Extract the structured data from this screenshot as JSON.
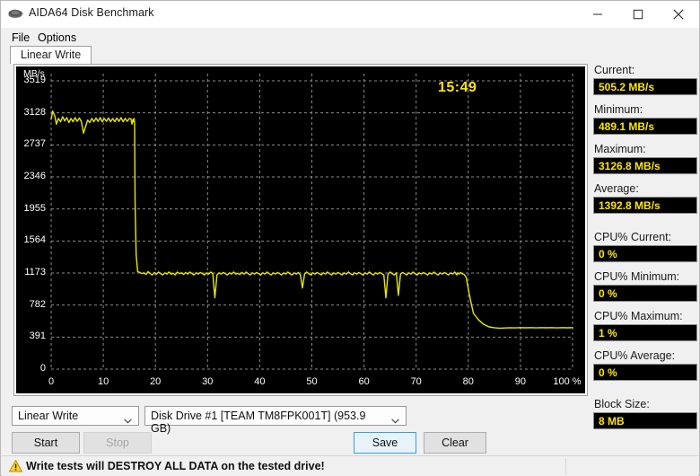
{
  "window": {
    "title": "AIDA64 Disk Benchmark",
    "app_icon": "disk-drive-icon",
    "minimize_label": "Minimize",
    "maximize_label": "Maximize",
    "close_label": "Close"
  },
  "menu": {
    "items": [
      "File",
      "Options"
    ]
  },
  "tabs": [
    {
      "label": "Linear Write",
      "active": true
    }
  ],
  "stats": [
    {
      "label": "Current:",
      "value": "505.2 MB/s",
      "gap": false
    },
    {
      "label": "Minimum:",
      "value": "489.1 MB/s",
      "gap": false
    },
    {
      "label": "Maximum:",
      "value": "3126.8 MB/s",
      "gap": false
    },
    {
      "label": "Average:",
      "value": "1392.8 MB/s",
      "gap": true
    },
    {
      "label": "CPU% Current:",
      "value": "0 %",
      "gap": false
    },
    {
      "label": "CPU% Minimum:",
      "value": "0 %",
      "gap": false
    },
    {
      "label": "CPU% Maximum:",
      "value": "1 %",
      "gap": false
    },
    {
      "label": "CPU% Average:",
      "value": "0 %",
      "gap": true
    },
    {
      "label": "Block Size:",
      "value": "8 MB",
      "gap": false
    }
  ],
  "controls": {
    "mode_select": "Linear Write",
    "drive_select": "Disk Drive #1  [TEAM TM8FPK001T]  (953.9 GB)",
    "start_label": "Start",
    "stop_label": "Stop",
    "stop_disabled": true,
    "save_label": "Save",
    "clear_label": "Clear"
  },
  "statusbar": {
    "warning_icon": "warning-triangle-icon",
    "text": "Write tests will DESTROY ALL DATA on the tested drive!"
  },
  "chart_data": {
    "type": "line",
    "title": "",
    "timer": "15:49",
    "xlabel": "%",
    "ylabel": "MB/s",
    "xlim": [
      0,
      100
    ],
    "ylim": [
      0,
      3519
    ],
    "grid": true,
    "trace_color": "#e8e800",
    "background": "#000000",
    "grid_color": "#8c8c8c",
    "xticks": [
      0,
      10,
      20,
      30,
      40,
      50,
      60,
      70,
      80,
      90,
      100
    ],
    "xtick_labels": [
      "0",
      "10",
      "20",
      "30",
      "40",
      "50",
      "60",
      "70",
      "80",
      "90",
      "100 %"
    ],
    "yticks": [
      0,
      391,
      782,
      1173,
      1564,
      1955,
      2346,
      2737,
      3128,
      3519
    ],
    "ytick_labels": [
      "0",
      "391",
      "782",
      "1173",
      "1564",
      "1955",
      "2346",
      "2737",
      "3128",
      "3519"
    ],
    "series": [
      {
        "name": "Linear Write speed",
        "x": [
          0,
          0.3,
          0.7,
          1,
          1.4,
          1.8,
          2.2,
          2.6,
          3,
          3.4,
          3.8,
          4.2,
          4.6,
          5,
          5.4,
          5.8,
          6.2,
          6.6,
          7,
          7.4,
          7.8,
          8.2,
          8.6,
          9,
          9.4,
          9.8,
          10.2,
          10.6,
          11,
          11.4,
          11.8,
          12.2,
          12.6,
          13,
          13.4,
          13.8,
          14.2,
          14.6,
          15,
          15.3,
          15.5,
          15.7,
          15.8,
          15.9,
          16,
          16.1,
          16.3,
          16.6,
          17,
          17.4,
          17.8,
          18.2,
          18.6,
          19,
          19.4,
          19.8,
          20.2,
          20.6,
          21,
          21.4,
          21.8,
          22.2,
          22.6,
          23,
          23.4,
          23.8,
          24.2,
          24.6,
          25,
          25.4,
          25.8,
          26.2,
          26.6,
          27,
          27.4,
          27.8,
          28.2,
          28.6,
          29,
          29.4,
          29.8,
          30.2,
          30.6,
          31,
          31.4,
          31.8,
          32.2,
          32.6,
          33,
          33.4,
          33.8,
          34.2,
          34.6,
          35,
          35.4,
          35.8,
          36.2,
          36.6,
          37,
          37.4,
          37.8,
          38.2,
          38.6,
          39,
          39.4,
          39.8,
          40.2,
          40.6,
          41,
          41.4,
          41.8,
          42.2,
          42.6,
          43,
          43.4,
          43.8,
          44.2,
          44.6,
          45,
          45.4,
          45.8,
          46.2,
          46.6,
          47,
          47.4,
          47.8,
          48.2,
          48.6,
          49,
          49.4,
          49.8,
          50.2,
          50.6,
          51,
          51.4,
          51.8,
          52.2,
          52.6,
          53,
          53.4,
          53.8,
          54.2,
          54.6,
          55,
          55.4,
          55.8,
          56.2,
          56.6,
          57,
          57.4,
          57.8,
          58.2,
          58.6,
          59,
          59.4,
          59.8,
          60.2,
          60.6,
          61,
          61.4,
          61.8,
          62.2,
          62.6,
          63,
          63.4,
          63.8,
          64.2,
          64.6,
          65,
          65.4,
          65.8,
          66.2,
          66.6,
          67,
          67.4,
          67.8,
          68.2,
          68.6,
          69,
          69.4,
          69.8,
          70.2,
          70.6,
          71,
          71.4,
          71.8,
          72.2,
          72.6,
          73,
          73.4,
          73.8,
          74.2,
          74.6,
          75,
          75.4,
          75.8,
          76.2,
          76.6,
          77,
          77.4,
          77.6,
          77.8,
          78,
          78.2,
          78.5,
          78.8,
          79.2,
          79.6,
          80,
          80.5,
          81,
          82,
          83,
          84,
          85,
          86,
          87,
          88,
          89,
          90,
          91,
          92,
          93,
          94,
          95,
          96,
          97,
          98,
          99,
          100
        ],
        "y": [
          3050,
          3150,
          3090,
          2990,
          3060,
          3020,
          3080,
          3030,
          3070,
          3010,
          3060,
          3020,
          3070,
          3025,
          3065,
          3020,
          2880,
          2960,
          3040,
          3010,
          3060,
          3020,
          3065,
          3025,
          3070,
          3020,
          3060,
          3025,
          3065,
          3020,
          3060,
          3020,
          3065,
          3025,
          3070,
          3020,
          3060,
          3025,
          3060,
          3055,
          2990,
          3050,
          3020,
          3060,
          3000,
          2050,
          1400,
          1190,
          1180,
          1165,
          1175,
          1155,
          1190,
          1165,
          1150,
          1180,
          1160,
          1185,
          1165,
          1150,
          1175,
          1160,
          1185,
          1160,
          1170,
          1150,
          1185,
          1165,
          1175,
          1155,
          1180,
          1160,
          1185,
          1165,
          1150,
          1175,
          1160,
          1180,
          1165,
          1150,
          1175,
          1160,
          1185,
          1165,
          870,
          1150,
          1175,
          1160,
          1180,
          1165,
          1150,
          1175,
          1160,
          1185,
          1160,
          1170,
          1155,
          1180,
          1160,
          1185,
          1165,
          1150,
          1175,
          1160,
          1180,
          1165,
          1150,
          1175,
          1160,
          1185,
          1165,
          1150,
          1175,
          1160,
          1180,
          1165,
          1150,
          1175,
          1160,
          1185,
          1165,
          1150,
          1175,
          1160,
          1180,
          1150,
          990,
          1160,
          1185,
          1165,
          1150,
          1175,
          1160,
          1180,
          1165,
          1150,
          1175,
          1160,
          1185,
          1165,
          1150,
          1175,
          1160,
          1180,
          1165,
          1150,
          1175,
          1160,
          1185,
          1165,
          1150,
          1175,
          1160,
          1180,
          1165,
          1150,
          1175,
          1160,
          1185,
          1165,
          1150,
          1175,
          1160,
          1180,
          1165,
          1150,
          870,
          1160,
          1185,
          1165,
          1150,
          1175,
          900,
          1160,
          1180,
          1165,
          1150,
          1175,
          1160,
          1185,
          1165,
          1150,
          1175,
          1160,
          1180,
          1165,
          1150,
          1175,
          1160,
          1185,
          1165,
          1150,
          1175,
          1160,
          1180,
          1165,
          1150,
          1175,
          1160,
          1185,
          1165,
          1150,
          1175,
          1160,
          1180,
          1165,
          1155,
          1120,
          980,
          820,
          680,
          600,
          545,
          515,
          505,
          500,
          502,
          505,
          503,
          506,
          504,
          507,
          503,
          506,
          504,
          507,
          503,
          506,
          504,
          507,
          503,
          506,
          504,
          507,
          505
        ]
      }
    ],
    "annotations": [
      {
        "text": "15:49",
        "type": "elapsed-timer",
        "color": "#ffe500"
      }
    ]
  }
}
